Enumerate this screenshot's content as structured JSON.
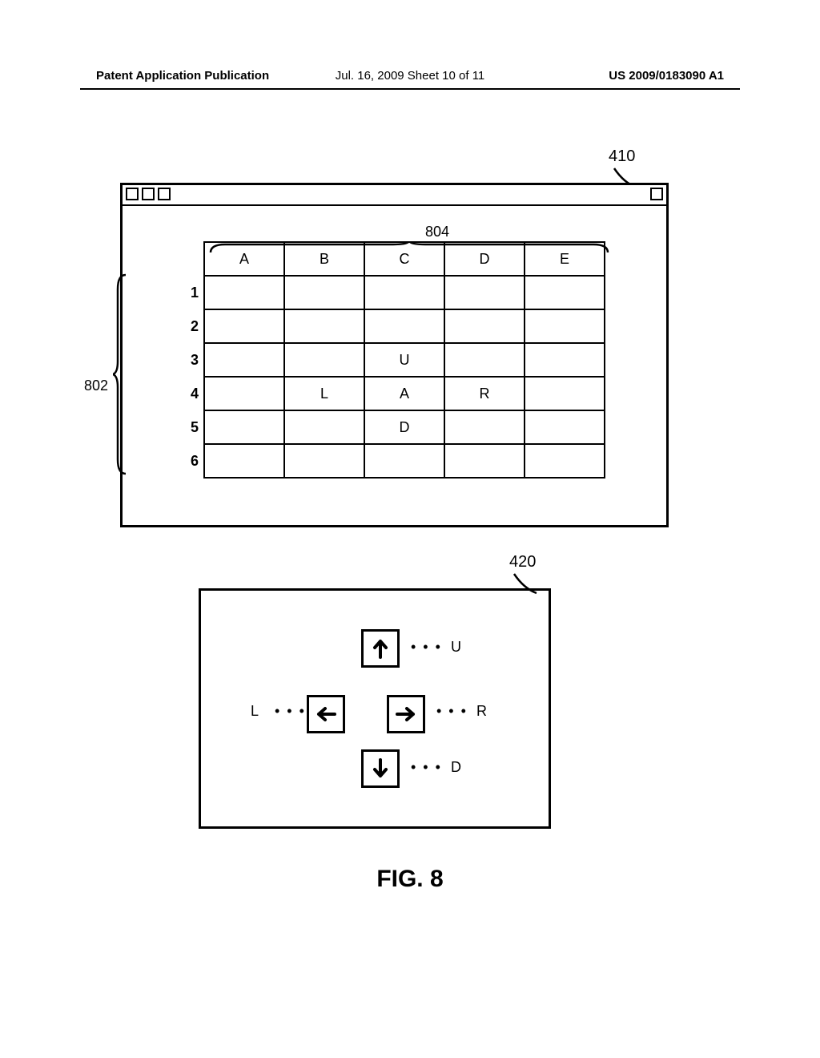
{
  "header": {
    "left": "Patent Application Publication",
    "center": "Jul. 16, 2009  Sheet 10 of 11",
    "right": "US 2009/0183090 A1"
  },
  "refs": {
    "r410": "410",
    "r420": "420",
    "r802": "802",
    "r804": "804"
  },
  "spreadsheet": {
    "columns": [
      "A",
      "B",
      "C",
      "D",
      "E"
    ],
    "rows": [
      "1",
      "2",
      "3",
      "4",
      "5",
      "6"
    ],
    "cells": {
      "C3": "U",
      "B4": "L",
      "C4": "A",
      "D4": "R",
      "C5": "D"
    }
  },
  "keypad": {
    "dots": "• • •",
    "U": "U",
    "L": "L",
    "R": "R",
    "D": "D"
  },
  "caption": "FIG. 8"
}
